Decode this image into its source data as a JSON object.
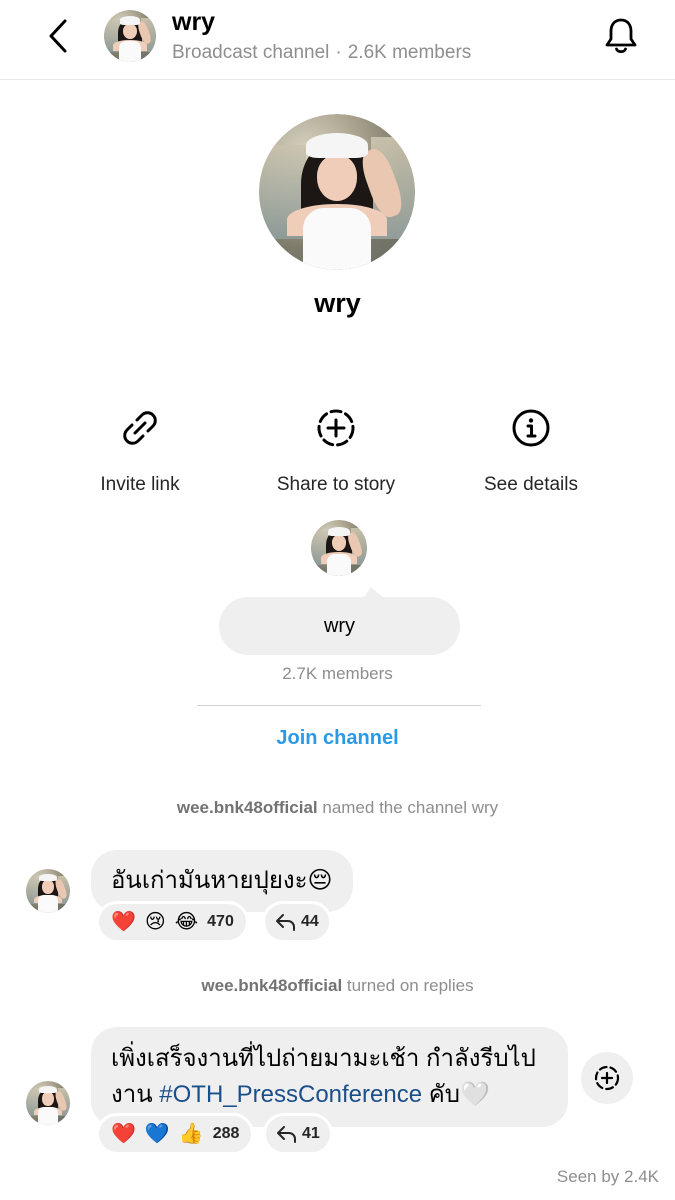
{
  "header": {
    "title": "wry",
    "subtitle_type": "Broadcast channel",
    "separator": "·",
    "member_count": "2.6K members",
    "back_icon": "chevron-left-icon",
    "notification_icon": "bell-icon"
  },
  "profile": {
    "name": "wry"
  },
  "actions": [
    {
      "label": "Invite link",
      "icon": "link-icon"
    },
    {
      "label": "Share to story",
      "icon": "dashed-circle-plus-icon"
    },
    {
      "label": "See details",
      "icon": "info-icon"
    }
  ],
  "channel_card": {
    "name": "wry",
    "members": "2.7K members",
    "join_label": "Join channel"
  },
  "system_messages": [
    {
      "user": "wee.bnk48official",
      "text": " named the channel wry"
    },
    {
      "user": "wee.bnk48official",
      "text": " turned on replies"
    }
  ],
  "messages": [
    {
      "text": "อันเก่ามันหายปุยงะ😔",
      "reactions": [
        "❤️",
        "😢",
        "😂"
      ],
      "reaction_count": "470",
      "reply_count": "44"
    },
    {
      "text_line1": "เพิ่งเสร็จงานที่ไปถ่ายมามะเช้า กำลังรีบไป",
      "text_line2_prefix": "งาน ",
      "hashtag": "#OTH_PressConference",
      "text_line2_suffix": " คับ🤍",
      "reactions": [
        "❤️",
        "💙",
        "👍"
      ],
      "reaction_count": "288",
      "reply_count": "41"
    }
  ],
  "seen_by": "Seen by 2.4K",
  "colors": {
    "accent": "#2a9ae8",
    "hashtag": "#1a4f8b",
    "bubble": "#efefef",
    "secondary_text": "#8e8e8e"
  }
}
